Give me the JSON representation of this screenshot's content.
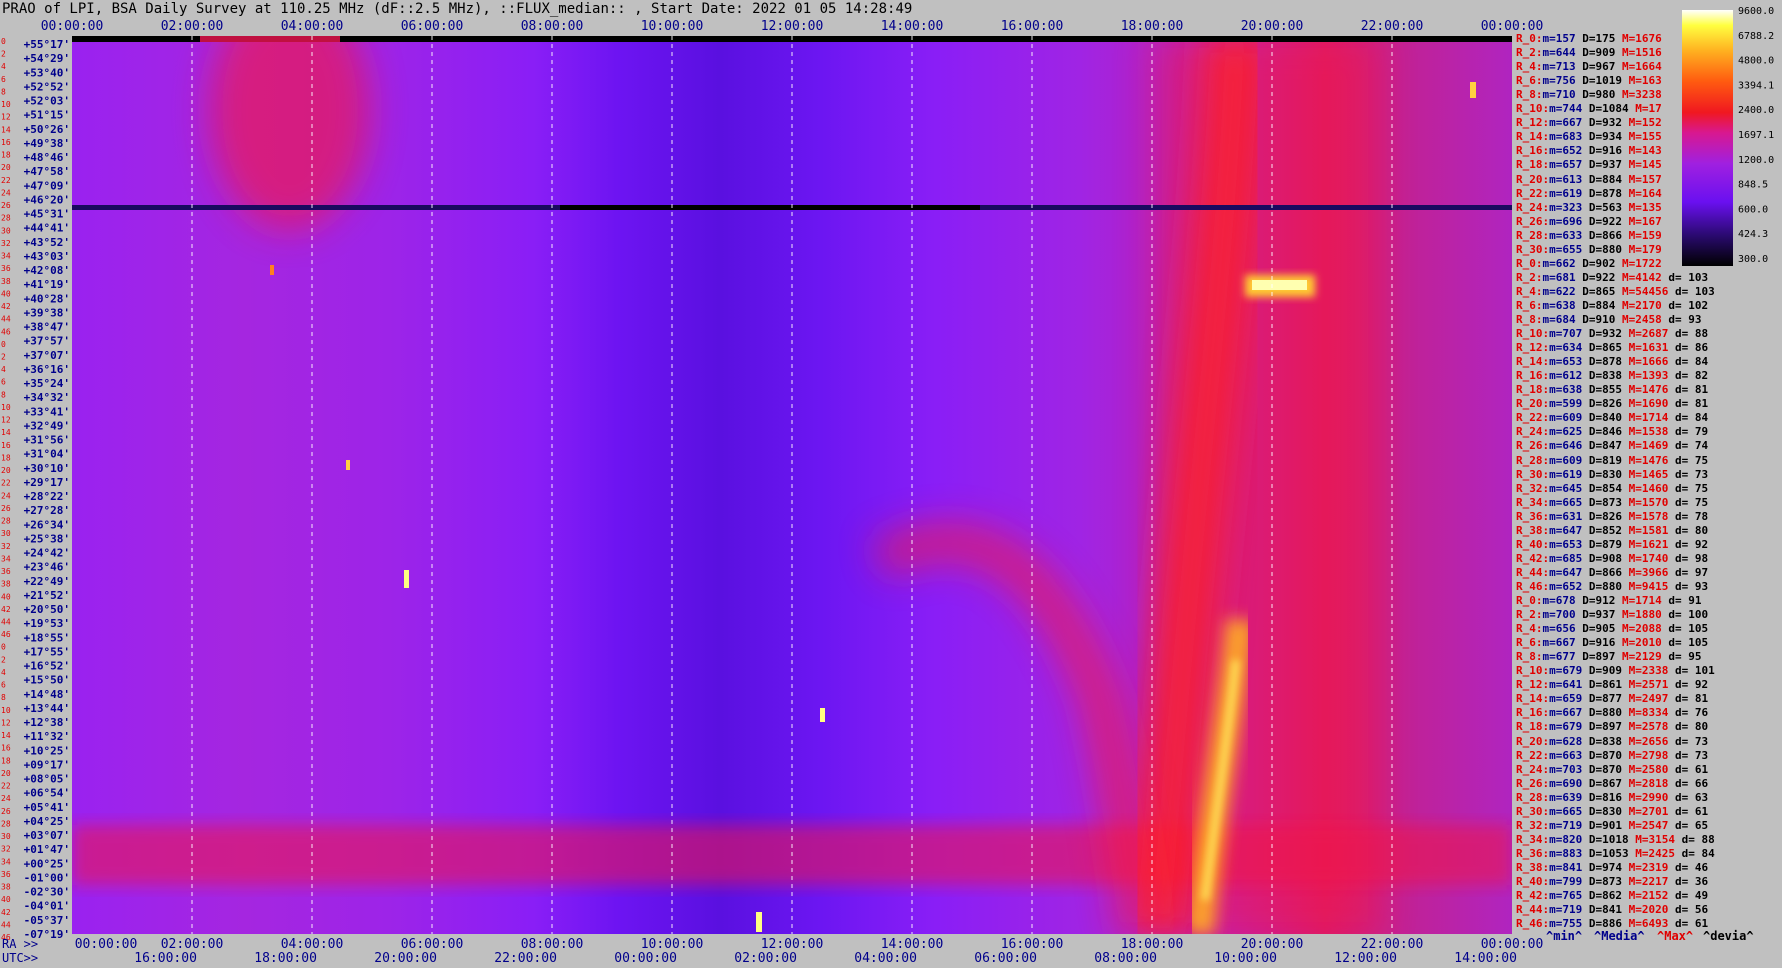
{
  "title": "PRAO of LPI, BSA Daily Survey at 110.25 MHz (dF::2.5 MHz), ::FLUX_median:: , Start Date: 2022 01 05 14:28:49",
  "colors": {
    "background": "#c0c0c0",
    "stat_label": "#e00000",
    "stat_value": "#00008b",
    "grid": "#ffffff"
  },
  "bottom_axis": {
    "ra_prefix": "RA >>",
    "utc_prefix": "UTC>>",
    "ra_labels": [
      "00:00:00",
      "02:00:00",
      "04:00:00",
      "06:00:00",
      "08:00:00",
      "10:00:00",
      "12:00:00",
      "14:00:00",
      "16:00:00",
      "18:00:00",
      "20:00:00",
      "22:00:00",
      "00:00:00"
    ],
    "utc_labels": [
      "16:00:00",
      "18:00:00",
      "20:00:00",
      "22:00:00",
      "00:00:00",
      "02:00:00",
      "04:00:00",
      "06:00:00",
      "08:00:00",
      "10:00:00",
      "12:00:00",
      "14:00:00"
    ]
  },
  "colorbar": {
    "ticks": [
      "9600.0",
      "6788.2",
      "4800.0",
      "3394.1",
      "2400.0",
      "1697.1",
      "1200.0",
      "848.5",
      "600.0",
      "424.3",
      "300.0"
    ]
  },
  "legend_footer": {
    "min": "^min^",
    "median": "^Media^",
    "max": "^Max^",
    "devia": "^devia^"
  },
  "chart_data": {
    "type": "heatmap",
    "title": "PRAO of LPI, BSA Daily Survey at 110.25 MHz (dF::2.5 MHz), ::FLUX_median:: , Start Date: 2022 01 05 14:28:49",
    "x_axis": {
      "quantity": "RA",
      "range": [
        "00:00:00",
        "24:00:00"
      ],
      "tick_step_hours": 2
    },
    "y_axis": {
      "quantity": "Dec",
      "row_index_labels": [
        "0",
        "2",
        "4",
        "6",
        "8",
        "10",
        "12",
        "14",
        "16",
        "18",
        "20",
        "22",
        "24",
        "26",
        "28",
        "30",
        "32",
        "34",
        "36",
        "38",
        "40",
        "42",
        "44",
        "46",
        "0",
        "2",
        "4",
        "6",
        "8",
        "10",
        "12",
        "14",
        "16",
        "18",
        "20",
        "22",
        "24",
        "26",
        "28",
        "30",
        "32",
        "34",
        "36",
        "38",
        "40",
        "42",
        "44",
        "46",
        "0",
        "2",
        "4",
        "6",
        "8",
        "10",
        "12",
        "14",
        "16",
        "18",
        "20",
        "22",
        "24",
        "26",
        "28",
        "30",
        "32",
        "34",
        "36",
        "38",
        "40",
        "42",
        "44",
        "46"
      ],
      "dec_labels": [
        "+55°17'",
        "+54°29'",
        "+53°40'",
        "+52°52'",
        "+52°03'",
        "+51°15'",
        "+50°26'",
        "+49°38'",
        "+48°46'",
        "+47°58'",
        "+47°09'",
        "+46°20'",
        "+45°31'",
        "+44°41'",
        "+43°52'",
        "+43°03'",
        "+42°08'",
        "+41°19'",
        "+40°28'",
        "+39°38'",
        "+38°47'",
        "+37°57'",
        "+37°07'",
        "+36°16'",
        "+35°24'",
        "+34°32'",
        "+33°41'",
        "+32°49'",
        "+31°56'",
        "+31°04'",
        "+30°10'",
        "+29°17'",
        "+28°22'",
        "+27°28'",
        "+26°34'",
        "+25°38'",
        "+24°42'",
        "+23°46'",
        "+22°49'",
        "+21°52'",
        "+20°50'",
        "+19°53'",
        "+18°55'",
        "+17°55'",
        "+16°52'",
        "+15°50'",
        "+14°48'",
        "+13°44'",
        "+12°38'",
        "+11°32'",
        "+10°25'",
        "+09°17'",
        "+08°05'",
        "+06°54'",
        "+05°41'",
        "+04°25'",
        "+03°07'",
        "+01°47'",
        "+00°25'",
        "-01°00'",
        "-02°30'",
        "-04°01'",
        "-05°37'",
        "-07°19'"
      ]
    },
    "colorbar_range": [
      300.0,
      9600.0
    ],
    "colorbar_scale": "log",
    "stats": [
      {
        "ray": "R_0:",
        "m": "157",
        "D": "175",
        "M": "1676",
        "d": ""
      },
      {
        "ray": "R_2:",
        "m": "644",
        "D": "909",
        "M": "1516",
        "d": ""
      },
      {
        "ray": "R_4:",
        "m": "713",
        "D": "967",
        "M": "1664",
        "d": ""
      },
      {
        "ray": "R_6:",
        "m": "756",
        "D": "1019",
        "M": "163",
        "d": ""
      },
      {
        "ray": "R_8:",
        "m": "710",
        "D": "980",
        "M": "3238",
        "d": ""
      },
      {
        "ray": "R_10:",
        "m": "744",
        "D": "1084",
        "M": "17",
        "d": ""
      },
      {
        "ray": "R_12:",
        "m": "667",
        "D": "932",
        "M": "152",
        "d": ""
      },
      {
        "ray": "R_14:",
        "m": "683",
        "D": "934",
        "M": "155",
        "d": ""
      },
      {
        "ray": "R_16:",
        "m": "652",
        "D": "916",
        "M": "143",
        "d": ""
      },
      {
        "ray": "R_18:",
        "m": "657",
        "D": "937",
        "M": "145",
        "d": ""
      },
      {
        "ray": "R_20:",
        "m": "613",
        "D": "884",
        "M": "157",
        "d": ""
      },
      {
        "ray": "R_22:",
        "m": "619",
        "D": "878",
        "M": "164",
        "d": ""
      },
      {
        "ray": "R_24:",
        "m": "323",
        "D": "563",
        "M": "135",
        "d": ""
      },
      {
        "ray": "R_26:",
        "m": "696",
        "D": "922",
        "M": "167",
        "d": ""
      },
      {
        "ray": "R_28:",
        "m": "633",
        "D": "866",
        "M": "159",
        "d": ""
      },
      {
        "ray": "R_30:",
        "m": "655",
        "D": "880",
        "M": "179",
        "d": ""
      },
      {
        "ray": "R_0:",
        "m": "662",
        "D": "902",
        "M": "1722",
        "d": ""
      },
      {
        "ray": "R_2:",
        "m": "681",
        "D": "922",
        "M": "4142",
        "d": "103"
      },
      {
        "ray": "R_4:",
        "m": "622",
        "D": "865",
        "M": "54456",
        "d": "103"
      },
      {
        "ray": "R_6:",
        "m": "638",
        "D": "884",
        "M": "2170",
        "d": "102"
      },
      {
        "ray": "R_8:",
        "m": "684",
        "D": "910",
        "M": "2458",
        "d": "93"
      },
      {
        "ray": "R_10:",
        "m": "707",
        "D": "932",
        "M": "2687",
        "d": "88"
      },
      {
        "ray": "R_12:",
        "m": "634",
        "D": "865",
        "M": "1631",
        "d": "86"
      },
      {
        "ray": "R_14:",
        "m": "653",
        "D": "878",
        "M": "1666",
        "d": "84"
      },
      {
        "ray": "R_16:",
        "m": "612",
        "D": "838",
        "M": "1393",
        "d": "82"
      },
      {
        "ray": "R_18:",
        "m": "638",
        "D": "855",
        "M": "1476",
        "d": "81"
      },
      {
        "ray": "R_20:",
        "m": "599",
        "D": "826",
        "M": "1690",
        "d": "81"
      },
      {
        "ray": "R_22:",
        "m": "609",
        "D": "840",
        "M": "1714",
        "d": "84"
      },
      {
        "ray": "R_24:",
        "m": "625",
        "D": "846",
        "M": "1538",
        "d": "79"
      },
      {
        "ray": "R_26:",
        "m": "646",
        "D": "847",
        "M": "1469",
        "d": "74"
      },
      {
        "ray": "R_28:",
        "m": "609",
        "D": "819",
        "M": "1476",
        "d": "75"
      },
      {
        "ray": "R_30:",
        "m": "619",
        "D": "830",
        "M": "1465",
        "d": "73"
      },
      {
        "ray": "R_32:",
        "m": "645",
        "D": "854",
        "M": "1460",
        "d": "75"
      },
      {
        "ray": "R_34:",
        "m": "665",
        "D": "873",
        "M": "1570",
        "d": "75"
      },
      {
        "ray": "R_36:",
        "m": "631",
        "D": "826",
        "M": "1578",
        "d": "78"
      },
      {
        "ray": "R_38:",
        "m": "647",
        "D": "852",
        "M": "1581",
        "d": "80"
      },
      {
        "ray": "R_40:",
        "m": "653",
        "D": "879",
        "M": "1621",
        "d": "92"
      },
      {
        "ray": "R_42:",
        "m": "685",
        "D": "908",
        "M": "1740",
        "d": "98"
      },
      {
        "ray": "R_44:",
        "m": "647",
        "D": "866",
        "M": "3966",
        "d": "97"
      },
      {
        "ray": "R_46:",
        "m": "652",
        "D": "880",
        "M": "9415",
        "d": "93"
      },
      {
        "ray": "R_0:",
        "m": "678",
        "D": "912",
        "M": "1714",
        "d": "91"
      },
      {
        "ray": "R_2:",
        "m": "700",
        "D": "937",
        "M": "1880",
        "d": "100"
      },
      {
        "ray": "R_4:",
        "m": "656",
        "D": "905",
        "M": "2088",
        "d": "105"
      },
      {
        "ray": "R_6:",
        "m": "667",
        "D": "916",
        "M": "2010",
        "d": "105"
      },
      {
        "ray": "R_8:",
        "m": "677",
        "D": "897",
        "M": "2129",
        "d": "95"
      },
      {
        "ray": "R_10:",
        "m": "679",
        "D": "909",
        "M": "2338",
        "d": "101"
      },
      {
        "ray": "R_12:",
        "m": "641",
        "D": "861",
        "M": "2571",
        "d": "92"
      },
      {
        "ray": "R_14:",
        "m": "659",
        "D": "877",
        "M": "2497",
        "d": "81"
      },
      {
        "ray": "R_16:",
        "m": "667",
        "D": "880",
        "M": "8334",
        "d": "76"
      },
      {
        "ray": "R_18:",
        "m": "679",
        "D": "897",
        "M": "2578",
        "d": "80"
      },
      {
        "ray": "R_20:",
        "m": "628",
        "D": "838",
        "M": "2656",
        "d": "73"
      },
      {
        "ray": "R_22:",
        "m": "663",
        "D": "870",
        "M": "2798",
        "d": "73"
      },
      {
        "ray": "R_24:",
        "m": "703",
        "D": "870",
        "M": "2580",
        "d": "61"
      },
      {
        "ray": "R_26:",
        "m": "690",
        "D": "867",
        "M": "2818",
        "d": "66"
      },
      {
        "ray": "R_28:",
        "m": "639",
        "D": "816",
        "M": "2990",
        "d": "63"
      },
      {
        "ray": "R_30:",
        "m": "665",
        "D": "830",
        "M": "2701",
        "d": "61"
      },
      {
        "ray": "R_32:",
        "m": "719",
        "D": "901",
        "M": "2547",
        "d": "65"
      },
      {
        "ray": "R_34:",
        "m": "820",
        "D": "1018",
        "M": "3154",
        "d": "88"
      },
      {
        "ray": "R_36:",
        "m": "883",
        "D": "1053",
        "M": "2425",
        "d": "84"
      },
      {
        "ray": "R_38:",
        "m": "841",
        "D": "974",
        "M": "2319",
        "d": "46"
      },
      {
        "ray": "R_40:",
        "m": "799",
        "D": "873",
        "M": "2217",
        "d": "36"
      },
      {
        "ray": "R_42:",
        "m": "765",
        "D": "862",
        "M": "2152",
        "d": "49"
      },
      {
        "ray": "R_44:",
        "m": "719",
        "D": "841",
        "M": "2020",
        "d": "56"
      },
      {
        "ray": "R_46:",
        "m": "755",
        "D": "886",
        "M": "6493",
        "d": "61"
      }
    ]
  }
}
